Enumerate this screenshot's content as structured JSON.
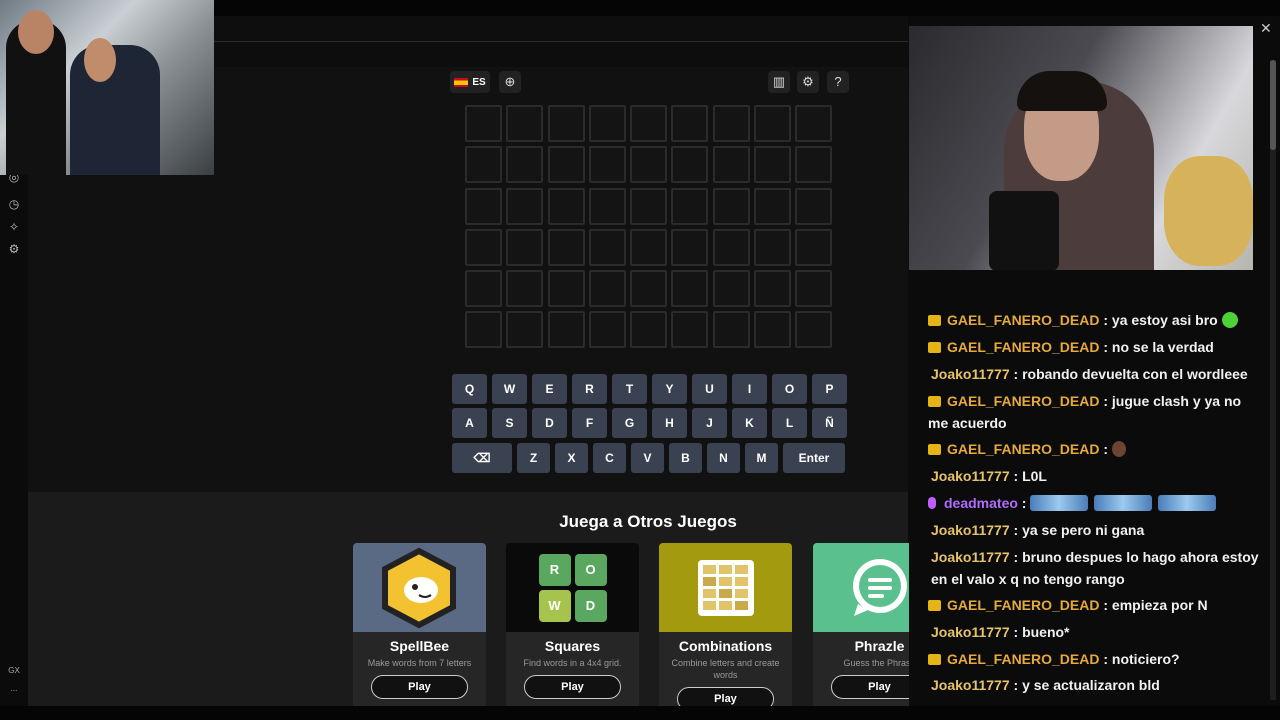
{
  "game": {
    "language": "ES",
    "rows": 6,
    "cols": 9,
    "keyboard": {
      "row1": [
        "Q",
        "W",
        "E",
        "R",
        "T",
        "Y",
        "U",
        "I",
        "O",
        "P"
      ],
      "row2": [
        "A",
        "S",
        "D",
        "F",
        "G",
        "H",
        "J",
        "K",
        "L",
        "Ñ"
      ],
      "row3": [
        "Z",
        "X",
        "C",
        "V",
        "B",
        "N",
        "M"
      ],
      "enter": "Enter"
    }
  },
  "other_games": {
    "title": "Juega a Otros Juegos",
    "cards": [
      {
        "name": "SpellBee",
        "desc": "Make words from 7 letters",
        "play": "Play"
      },
      {
        "name": "Squares",
        "desc": "Find words in a 4x4 grid.",
        "play": "Play"
      },
      {
        "name": "Combinations",
        "desc": "Combine letters and create words",
        "play": "Play"
      },
      {
        "name": "Phrazle",
        "desc": "Guess the Phrase",
        "play": "Play"
      }
    ],
    "squares_letters": [
      "R",
      "O",
      "W",
      "D"
    ]
  },
  "sidebar": {
    "gx_label": "GX",
    "more_label": "..."
  },
  "chat": {
    "messages": [
      {
        "user": "GAEL_FANERO_DEAD",
        "text": ": ya estoy asi bro ",
        "badge": "crown",
        "emote": "green-face"
      },
      {
        "user": "GAEL_FANERO_DEAD",
        "text": ": no se la verdad",
        "badge": "crown"
      },
      {
        "user": "Joako11777",
        "text": ": robando devuelta con el wordleee",
        "badge": "none"
      },
      {
        "user": "GAEL_FANERO_DEAD",
        "text": ": jugue clash y ya no me acuerdo",
        "badge": "crown"
      },
      {
        "user": "GAEL_FANERO_DEAD",
        "text": ": ",
        "badge": "crown",
        "emote": "face"
      },
      {
        "user": "Joako11777",
        "text": ": L0L",
        "badge": "none"
      },
      {
        "user": "deadmateo",
        "text": ": ",
        "badge": "mic",
        "emote": "cars"
      },
      {
        "user": "Joako11777",
        "text": ": ya se pero ni gana",
        "badge": "none"
      },
      {
        "user": "Joako11777",
        "text": ": bruno despues lo hago ahora estoy en el valo x q no tengo rango",
        "badge": "none"
      },
      {
        "user": "GAEL_FANERO_DEAD",
        "text": ": empieza por N",
        "badge": "crown"
      },
      {
        "user": "Joako11777",
        "text": ": bueno*",
        "badge": "none"
      },
      {
        "user": "GAEL_FANERO_DEAD",
        "text": ": noticiero?",
        "badge": "crown"
      },
      {
        "user": "Joako11777",
        "text": ": y se actualizaron bld",
        "badge": "none"
      }
    ]
  },
  "colors": {
    "gael": "#e5a93c",
    "joako": "#e6c36a",
    "deadmateo": "#b16bff",
    "key_bg": "#3a4150",
    "spellbee_bg": "#5a6a84",
    "squares_bg": "#0a0a0a",
    "combinations_bg": "#a39a10",
    "phrazle_bg": "#5ac08d"
  }
}
